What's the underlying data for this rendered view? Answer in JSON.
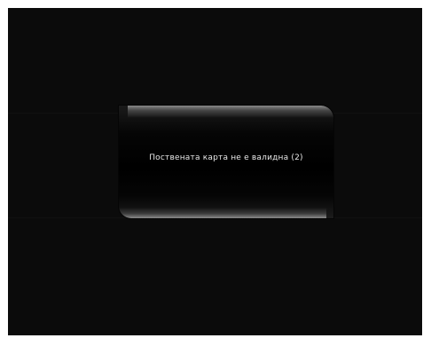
{
  "dialog": {
    "message": "Поствената карта не е валидна (2)"
  },
  "colors": {
    "screen_background": "#0b0b0b",
    "dialog_background": "#000000",
    "dialog_highlight": "#8a8a8a",
    "message_text": "#e8e8e8"
  }
}
